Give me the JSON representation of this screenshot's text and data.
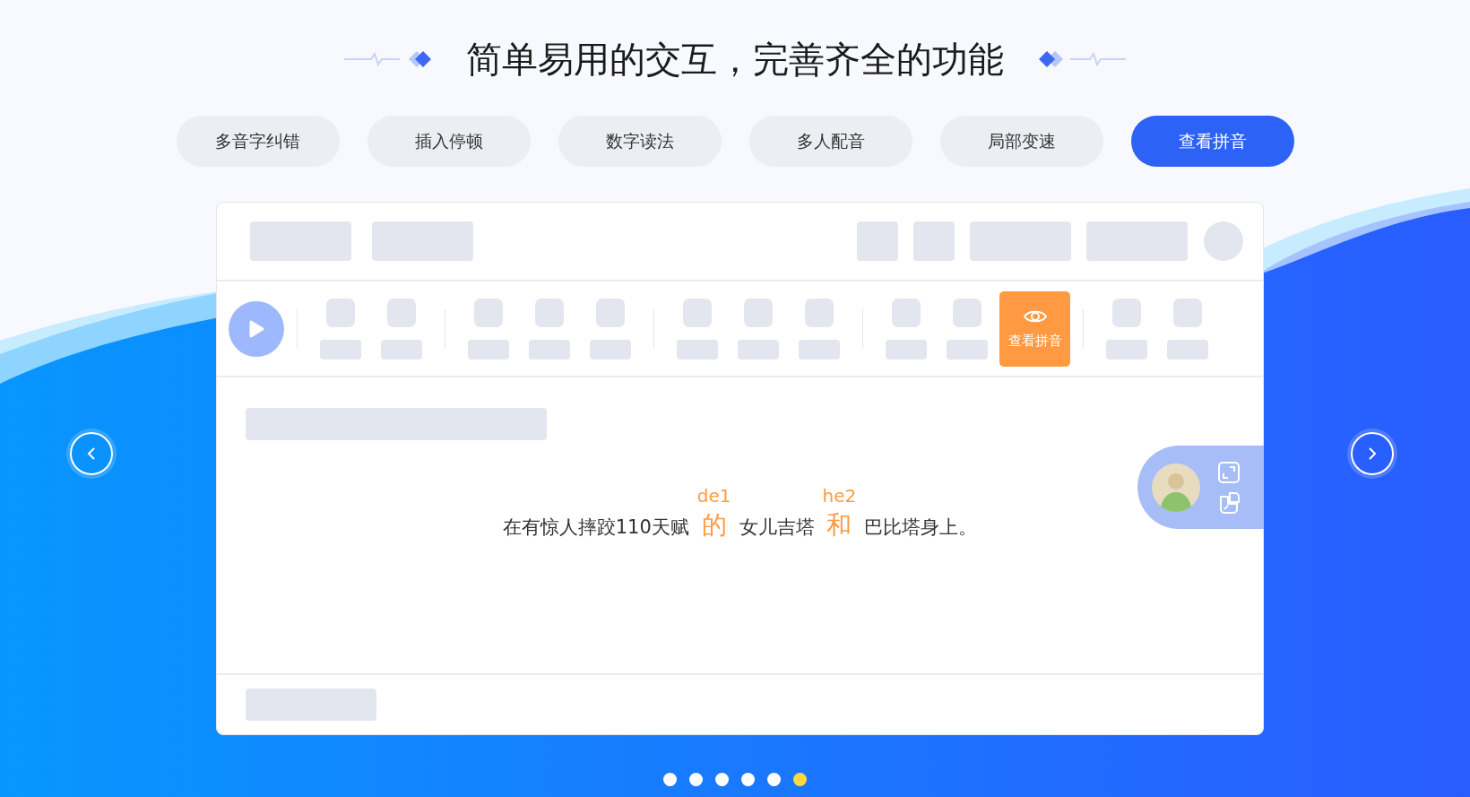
{
  "title": "简单易用的交互，完善齐全的功能",
  "tabs": [
    {
      "label": "多音字纠错",
      "selected": false
    },
    {
      "label": "插入停顿",
      "selected": false
    },
    {
      "label": "数字读法",
      "selected": false
    },
    {
      "label": "多人配音",
      "selected": false
    },
    {
      "label": "局部变速",
      "selected": false
    },
    {
      "label": "查看拼音",
      "selected": true
    }
  ],
  "demo": {
    "active_tool": {
      "label": "查看拼音"
    },
    "sentence": [
      {
        "kind": "plain",
        "text": "在有惊人摔跤110天赋"
      },
      {
        "kind": "annotated",
        "text": "的",
        "pinyin": "de1"
      },
      {
        "kind": "plain",
        "text": "女儿吉塔"
      },
      {
        "kind": "annotated",
        "text": "和",
        "pinyin": "he2"
      },
      {
        "kind": "plain",
        "text": "巴比塔身上。"
      }
    ]
  },
  "carousel_dots": [
    {
      "selected": false
    },
    {
      "selected": false
    },
    {
      "selected": false
    },
    {
      "selected": false
    },
    {
      "selected": false
    },
    {
      "selected": true
    }
  ]
}
